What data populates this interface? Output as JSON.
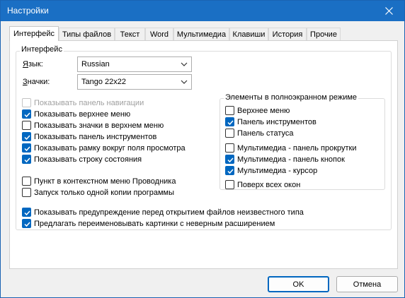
{
  "window": {
    "title": "Настройки"
  },
  "tabs": [
    {
      "label": "Интерфейс"
    },
    {
      "label": "Типы файлов"
    },
    {
      "label": "Текст"
    },
    {
      "label": "Word"
    },
    {
      "label": "Мультимедиа"
    },
    {
      "label": "Клавиши"
    },
    {
      "label": "История"
    },
    {
      "label": "Прочие"
    }
  ],
  "group": {
    "title": "Интерфейс"
  },
  "language": {
    "label_first": "Я",
    "label_rest": "зык:",
    "value": "Russian"
  },
  "icons_set": {
    "label_first": "З",
    "label_rest": "начки:",
    "value": "Tango 22x22"
  },
  "left_checks": [
    {
      "label": "Показывать панель навигации",
      "checked": false,
      "disabled": true
    },
    {
      "label": "Показывать верхнее меню",
      "checked": true,
      "disabled": false
    },
    {
      "label": "Показывать значки в верхнем меню",
      "checked": false,
      "disabled": false
    },
    {
      "label": "Показывать панель инструментов",
      "checked": true,
      "disabled": false
    },
    {
      "label": "Показывать рамку вокруг поля просмотра",
      "checked": true,
      "disabled": false
    },
    {
      "label": "Показывать строку состояния",
      "checked": true,
      "disabled": false
    }
  ],
  "extra_checks": [
    {
      "label": "Пункт в контекстном меню Проводника",
      "checked": false
    },
    {
      "label": "Запуск только одной копии программы",
      "checked": false
    }
  ],
  "fullscreen": {
    "title": "Элементы в полноэкранном режиме",
    "items": [
      {
        "label": "Верхнее меню",
        "checked": false
      },
      {
        "label": "Панель инструментов",
        "checked": true
      },
      {
        "label": "Панель статуса",
        "checked": false
      },
      {
        "label": "Мультимедиа - панель прокрутки",
        "checked": false
      },
      {
        "label": "Мультимедиа - панель кнопок",
        "checked": true
      },
      {
        "label": "Мультимедиа - курсор",
        "checked": true
      },
      {
        "label": "Поверх всех окон",
        "checked": false
      }
    ]
  },
  "bottom_checks": [
    {
      "label": "Показывать предупреждение перед открытием файлов неизвестного типа",
      "checked": true
    },
    {
      "label": "Предлагать переименовывать картинки с неверным расширением",
      "checked": true
    }
  ],
  "buttons": {
    "ok": "OK",
    "cancel": "Отмена"
  }
}
